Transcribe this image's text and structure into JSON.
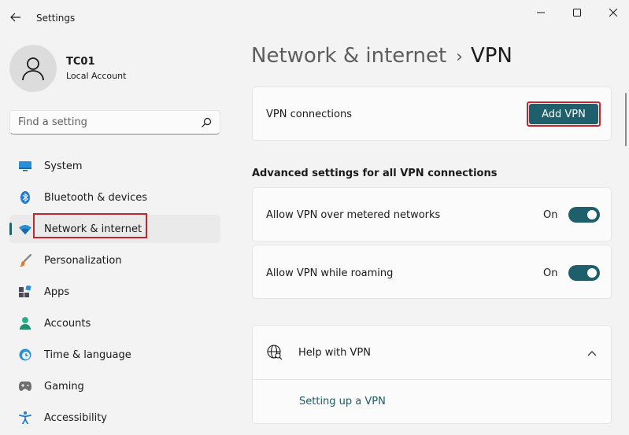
{
  "window": {
    "title": "Settings"
  },
  "profile": {
    "name": "TC01",
    "account_type": "Local Account"
  },
  "search": {
    "placeholder": "Find a setting",
    "value": ""
  },
  "sidebar": {
    "items": [
      {
        "label": "System",
        "icon": "monitor-icon"
      },
      {
        "label": "Bluetooth & devices",
        "icon": "bluetooth-icon"
      },
      {
        "label": "Network & internet",
        "icon": "wifi-icon",
        "active": true
      },
      {
        "label": "Personalization",
        "icon": "brush-icon"
      },
      {
        "label": "Apps",
        "icon": "apps-icon"
      },
      {
        "label": "Accounts",
        "icon": "person-icon"
      },
      {
        "label": "Time & language",
        "icon": "clock-globe-icon"
      },
      {
        "label": "Gaming",
        "icon": "gamepad-icon"
      },
      {
        "label": "Accessibility",
        "icon": "accessibility-icon"
      }
    ]
  },
  "breadcrumb": {
    "parent": "Network & internet",
    "separator": "›",
    "current": "VPN"
  },
  "vpn_connections": {
    "label": "VPN connections",
    "add_button": "Add VPN"
  },
  "advanced": {
    "heading": "Advanced settings for all VPN connections",
    "metered": {
      "label": "Allow VPN over metered networks",
      "state": "On"
    },
    "roaming": {
      "label": "Allow VPN while roaming",
      "state": "On"
    }
  },
  "help": {
    "title": "Help with VPN",
    "link": "Setting up a VPN"
  },
  "colors": {
    "accent": "#1f5f6b",
    "highlight": "#c4262e",
    "background": "#f3f3f3",
    "card": "#fbfbfb"
  }
}
